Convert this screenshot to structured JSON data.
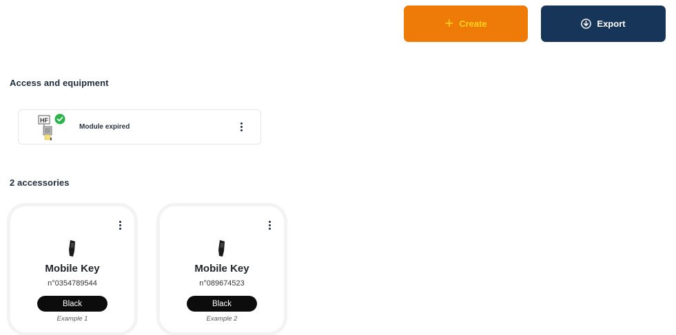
{
  "toolbar": {
    "create_label": "Create",
    "create_icon": "plus-icon",
    "export_label": "Export",
    "export_icon": "download-circle-icon",
    "create_color": "#ee7a07",
    "create_text_color": "#ffd21c",
    "export_color": "#173559"
  },
  "access_section": {
    "title": "Access and equipment",
    "module": {
      "icon": "hf-module-icon",
      "icon_text": "HF",
      "status_icon": "check-circle-icon",
      "status_color": "#2bb24a",
      "label": "Module expired",
      "menu_icon": "kebab-menu-icon"
    }
  },
  "accessories_section": {
    "title": "2 accessories",
    "items": [
      {
        "icon": "mobile-key-icon",
        "name": "Mobile Key",
        "number": "n°0354789544",
        "color_label": "Black",
        "example": "Example 1",
        "menu_icon": "kebab-menu-icon"
      },
      {
        "icon": "mobile-key-icon",
        "name": "Mobile Key",
        "number": "n°089674523",
        "color_label": "Black",
        "example": "Example 2",
        "menu_icon": "kebab-menu-icon"
      }
    ]
  }
}
